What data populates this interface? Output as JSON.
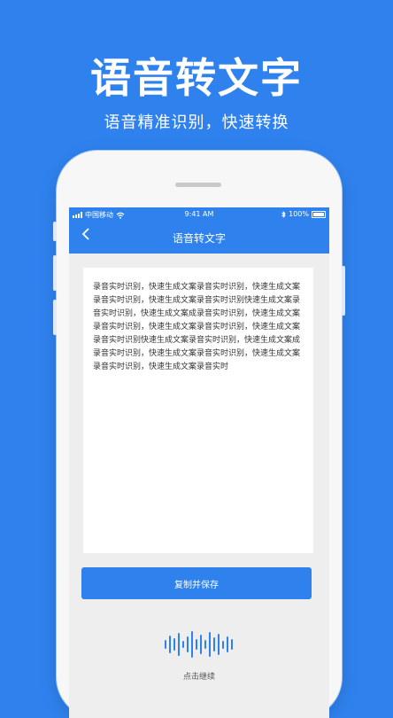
{
  "hero": {
    "title": "语音转文字",
    "subtitle": "语音精准识别，快速转换"
  },
  "statusbar": {
    "carrier": "中国移动",
    "time": "9:41 AM",
    "battery": "100%"
  },
  "navbar": {
    "back_icon": "chevron-left-icon",
    "title": "语音转文字"
  },
  "transcript": {
    "text": "录音实时识别，快速生成文案录音实时识别，快速生成文案录音实时识别，快速生成文案录音实时识别快速生成文案录音实时识别，快速生成文案成录音实时识别，快速生成文案录音实时识别，快速生成文案录音实时识别，快速生成文案录音实时识别快速生成文案录音实时识别，快速生成文案成录音实时识别，快速生成文案录音实时识别，快速生成文案录音实时识别，快速生成文案录音实时"
  },
  "actions": {
    "copy_save": "复制并保存",
    "continue_hint": "点击继续",
    "voice_icon": "voice-wave-icon"
  },
  "colors": {
    "brand": "#2f82ee",
    "background": "#2f82ee",
    "card": "#ffffff"
  }
}
